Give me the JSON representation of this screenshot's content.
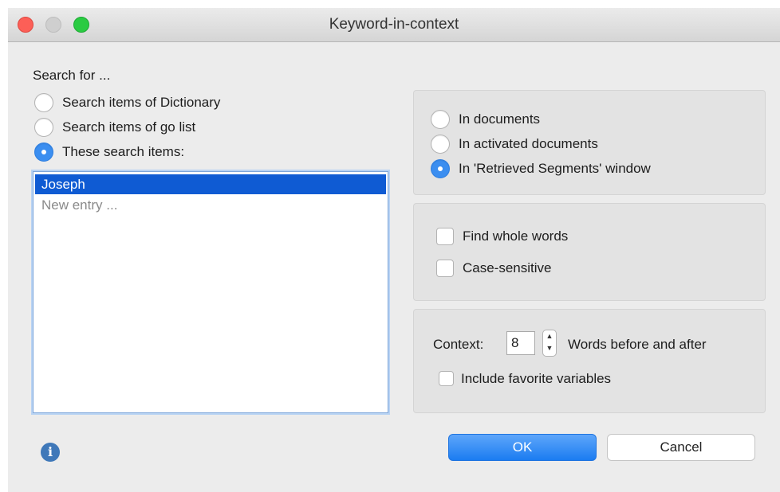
{
  "window": {
    "title": "Keyword-in-context"
  },
  "search": {
    "heading": "Search for ...",
    "options": [
      {
        "label": "Search items of Dictionary",
        "checked": false
      },
      {
        "label": "Search items of go list",
        "checked": false
      },
      {
        "label": "These search items:",
        "checked": true
      }
    ],
    "list": {
      "selected_item": "Joseph",
      "placeholder": "New entry ..."
    }
  },
  "scope": {
    "options": [
      {
        "label": "In documents",
        "checked": false
      },
      {
        "label": "In activated documents",
        "checked": false
      },
      {
        "label": "In 'Retrieved Segments' window",
        "checked": true
      }
    ]
  },
  "matching": {
    "find_whole_words": {
      "label": "Find whole words",
      "checked": false
    },
    "case_sensitive": {
      "label": "Case-sensitive",
      "checked": false
    }
  },
  "context": {
    "label": "Context:",
    "value": "8",
    "suffix": "Words before and after",
    "include_favorites": {
      "label": "Include favorite variables",
      "checked": false
    }
  },
  "buttons": {
    "ok": "OK",
    "cancel": "Cancel"
  },
  "icons": {
    "info": "info-icon",
    "stepper": "stepper-icon"
  },
  "colors": {
    "accent": "#3b8ef0",
    "selection": "#0f5bd3",
    "close": "#fc5f57",
    "maximize": "#2acb42"
  }
}
